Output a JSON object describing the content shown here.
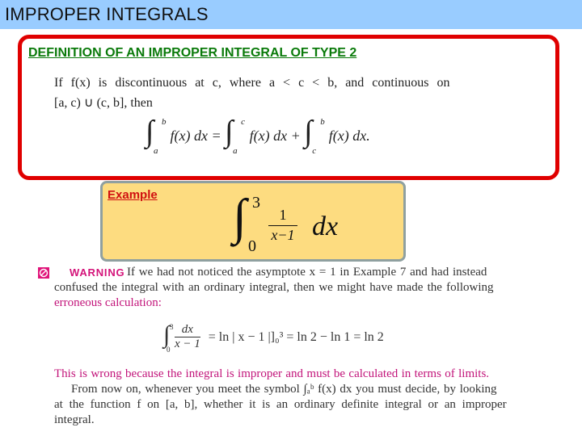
{
  "slide": {
    "title": "IMPROPER INTEGRALS"
  },
  "definition": {
    "heading": "DEFINITION OF AN IMPROPER INTEGRAL OF TYPE 2",
    "line1": "If f(x) is discontinuous at c, where a < c < b, and continuous on",
    "line2": "[a, c) ∪ (c, b], then",
    "equation": {
      "lhs_upper": "b",
      "lhs_lower": "a",
      "lhs_body": "f(x) dx =",
      "mid_upper": "c",
      "mid_lower": "a",
      "mid_body": "f(x) dx +",
      "rhs_upper": "b",
      "rhs_lower": "c",
      "rhs_body": "f(x) dx."
    }
  },
  "example": {
    "label": "Example",
    "integral_upper": "3",
    "integral_lower": "0",
    "numerator": "1",
    "denominator": "x−1",
    "differential": "dx"
  },
  "warning": {
    "icon": "no-entry-icon",
    "label": "WARNING",
    "line1": "If we had not noticed the asymptote x = 1 in Example 7 and had instead",
    "line2": "confused the integral with an ordinary integral, then we might have made the following",
    "line3": "erroneous calculation:",
    "calc": {
      "upper": "3",
      "lower": "0",
      "numerator": "dx",
      "denominator": "x − 1",
      "rest": "= ln | x − 1 |]₀³ = ln 2 − ln 1 = ln 2"
    },
    "para1": "This is wrong because the integral is improper and must be calculated in terms of limits.",
    "para2": "From now on, whenever you meet the symbol ∫ₐᵇ f(x) dx you must decide, by looking",
    "para3": "at the function f on [a, b], whether it is an ordinary definite integral or an improper",
    "para4": "integral."
  },
  "colors": {
    "title_bar": "#99ccff",
    "definition_border": "#e00000",
    "definition_heading": "#0a7a0a",
    "example_fill": "#fddc80",
    "example_label": "#d01010",
    "warning_accent": "#d4147a"
  }
}
